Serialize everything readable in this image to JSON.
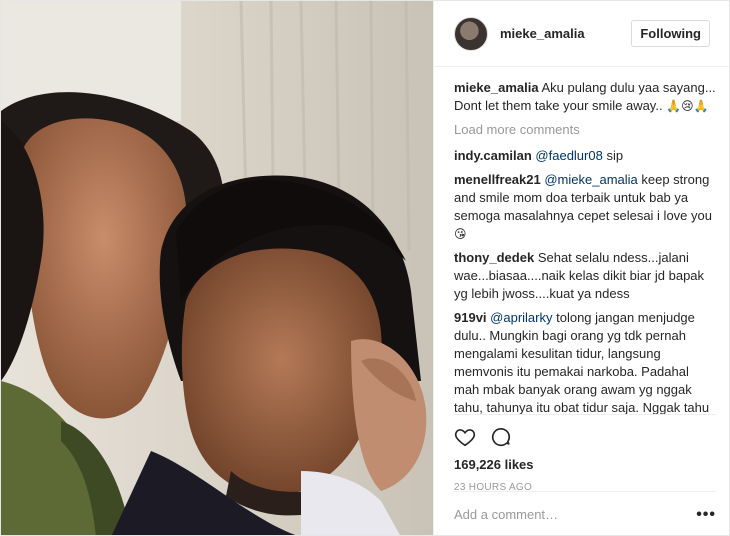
{
  "post": {
    "username": "mieke_amalia",
    "follow_label": "Following",
    "caption_user": "mieke_amalia",
    "caption_text": "Aku pulang dulu yaa sayang... Dont let them take your smile away..",
    "caption_emoji": "🙏😢🙏",
    "load_more": "Load more comments"
  },
  "comments": [
    {
      "user": "indy.camilan",
      "mention": "@faedlur08",
      "text": " sip",
      "emoji": ""
    },
    {
      "user": "menellfreak21",
      "mention": "@mieke_amalia",
      "text": " keep strong and smile mom doa terbaik untuk bab ya semoga masalahnya cepet selesai i love you",
      "emoji": "😘"
    },
    {
      "user": "thony_dedek",
      "mention": "",
      "text": "Sehat selalu ndess...jalani wae...biasaa....naik kelas dikit biar jd bapak yg lebih jwoss....kuat ya ndess",
      "emoji": ""
    },
    {
      "user": "919vi",
      "mention": "@aprilarky",
      "text": " tolong jangan menjudge dulu.. Mungkin bagi orang yg tdk pernah mengalami kesulitan tidur, langsung memvonis itu pemakai narkoba. Padahal mah mbak banyak orang awam yg nggak tahu, tahunya itu obat tidur saja. Nggak tahu itu masuk golongan mana. Nggak bisa tidur itu sengsara rasanya mbak, yiung2nya jadi sakit",
      "emoji": ""
    }
  ],
  "stats": {
    "likes": "169,226 likes",
    "time": "23 HOURS AGO"
  },
  "add_comment": {
    "placeholder": "Add a comment…",
    "more_label": "•••"
  },
  "icons": {
    "like": "heart-icon",
    "comment": "comment-bubble-icon",
    "options": "more-options-icon"
  }
}
